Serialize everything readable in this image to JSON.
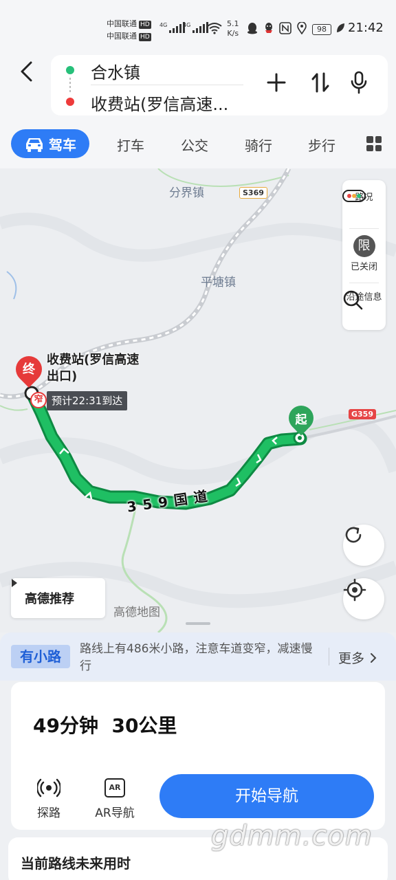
{
  "status_bar": {
    "carrier1": "中国联通",
    "carrier2": "中国联通",
    "hd": "HD",
    "net1": "4G",
    "net2": "4G",
    "speed_value": "5.1",
    "speed_unit": "K/s",
    "battery": "98",
    "time": "21:42",
    "icons": [
      "wifi-icon",
      "qq-icon",
      "penguin-icon",
      "nfc-icon",
      "location-icon",
      "leaf-icon"
    ]
  },
  "header": {
    "origin": "合水镇",
    "destination": "收费站(罗信高速...",
    "origin_color": "#27c07a",
    "destination_color": "#ee3b3b"
  },
  "modes": {
    "active": "驾车",
    "taxi": "打车",
    "bus": "公交",
    "bike": "骑行",
    "walk": "步行",
    "accent": "#2e7cf6"
  },
  "map": {
    "towns": [
      "分界镇",
      "平塘镇"
    ],
    "roads": {
      "provincial": "S369",
      "national": "G359"
    },
    "route_road_name": "359国道",
    "route_color": "#18b35a",
    "end_marker": "终",
    "end_name": "收费站(罗信高速出口)",
    "narrow_marker": "窄",
    "eta": "预计22:31到达",
    "start_marker": "起",
    "panel": {
      "traffic": "路况",
      "restriction_icon": "限",
      "restriction": "已关闭",
      "along": "沿途信息"
    },
    "recommend": "高德推荐",
    "brand_watermark": "高德地图"
  },
  "notice": {
    "tag": "有小路",
    "text": "路线上有486米小路，注意车道变窄，减速慢行",
    "more": "更多"
  },
  "summary": {
    "duration": "49分钟",
    "distance": "30公里",
    "explore": "探路",
    "ar_nav": "AR导航",
    "ar_icon_text": "AR",
    "start_nav": "开始导航"
  },
  "future": {
    "title": "当前路线未来用时"
  },
  "site_watermark": "gdmm.com"
}
